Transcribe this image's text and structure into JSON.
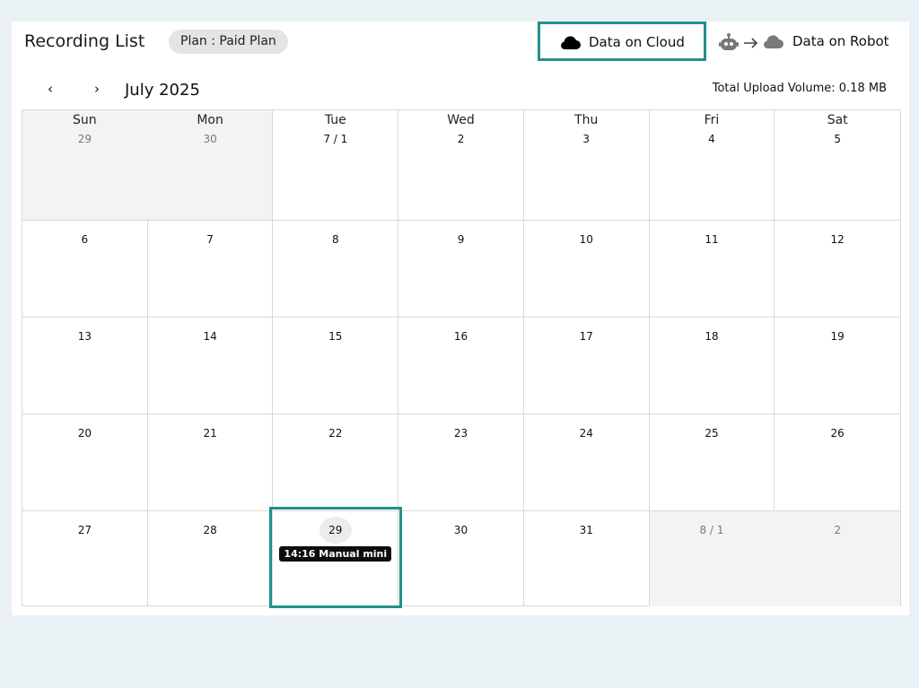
{
  "header": {
    "title": "Recording List",
    "plan": "Plan : Paid Plan",
    "view_cloud_label": "Data on Cloud",
    "view_robot_label": "Data on Robot"
  },
  "nav": {
    "prev": "‹",
    "next": "›",
    "month": "July 2025",
    "upload_volume": "Total Upload Volume: 0.18 MB"
  },
  "calendar": {
    "weekdays": [
      "Sun",
      "Mon",
      "Tue",
      "Wed",
      "Thu",
      "Fri",
      "Sat"
    ],
    "weeks": [
      [
        "29",
        "30",
        "7 / 1",
        "2",
        "3",
        "4",
        "5"
      ],
      [
        "6",
        "7",
        "8",
        "9",
        "10",
        "11",
        "12"
      ],
      [
        "13",
        "14",
        "15",
        "16",
        "17",
        "18",
        "19"
      ],
      [
        "20",
        "21",
        "22",
        "23",
        "24",
        "25",
        "26"
      ],
      [
        "27",
        "28",
        "29",
        "30",
        "31",
        "8 / 1",
        "2"
      ]
    ],
    "event": "14:16 Manual mini"
  },
  "colors": {
    "highlight": "#23908e",
    "event_bg": "#0d0d0d",
    "page_bg": "#eaf1f5"
  }
}
